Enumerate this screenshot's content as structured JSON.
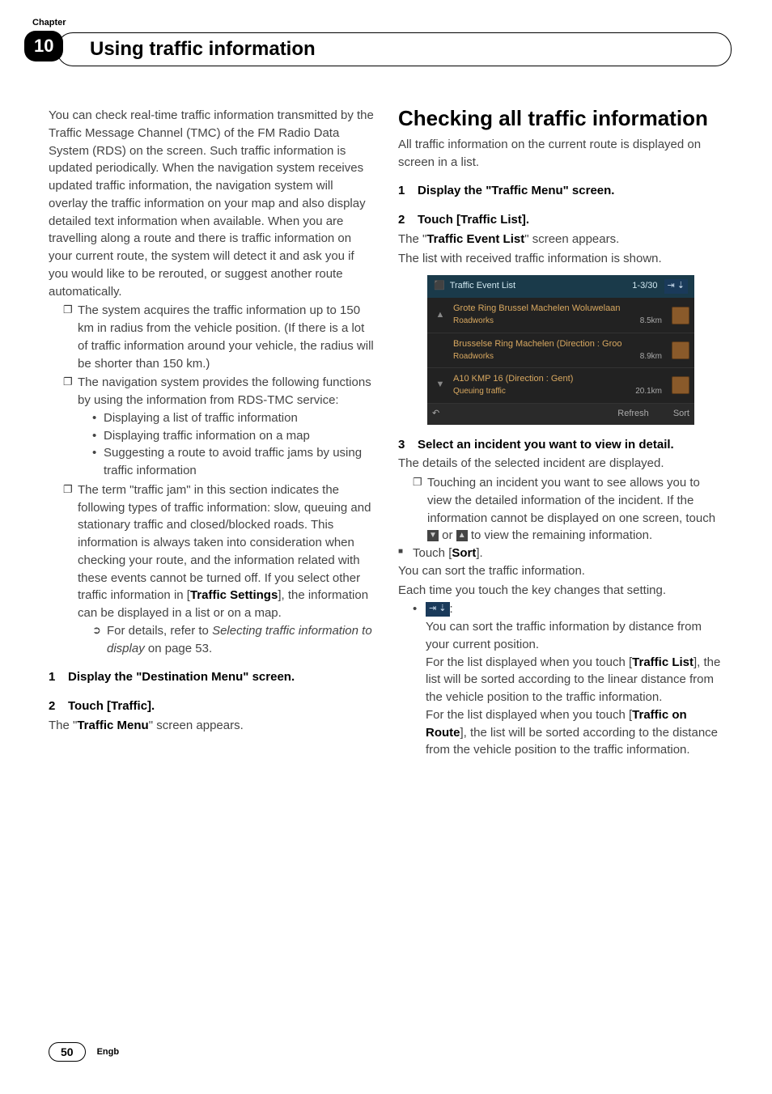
{
  "header": {
    "chapter_label": "Chapter",
    "chapter_number": "10",
    "chapter_title": "Using traffic information"
  },
  "left": {
    "intro": "You can check real-time traffic information transmitted by the Traffic Message Channel (TMC) of the FM Radio Data System (RDS) on the screen. Such traffic information is updated periodically. When the navigation system receives updated traffic information, the navigation system will overlay the traffic information on your map and also display detailed text information when available. When you are travelling along a route and there is traffic information on your current route, the system will detect it and ask you if you would like to be rerouted, or suggest another route automatically.",
    "b1": "The system acquires the traffic information up to 150 km in radius from the vehicle position. (If there is a lot of traffic information around your vehicle, the radius will be shorter than 150 km.)",
    "b2": "The navigation system provides the following functions by using the information from RDS-TMC service:",
    "b2s1": "Displaying a list of traffic information",
    "b2s2": "Displaying traffic information on a map",
    "b2s3": "Suggesting a route to avoid traffic jams by using traffic information",
    "b3a": "The term \"traffic jam\" in this section indicates the following types of traffic information: slow, queuing and stationary traffic and closed/blocked roads. This information is always taken into consideration when checking your route, and the information related with these events cannot be turned off. If you select other traffic information in [",
    "b3bold": "Traffic Settings",
    "b3b": "], the information can be displayed in a list or on a map.",
    "b3ref_a": "For details, refer to ",
    "b3ref_i": "Selecting traffic information to display",
    "b3ref_b": " on page 53.",
    "step1": "Display the \"Destination Menu\" screen.",
    "step2": "Touch [Traffic].",
    "step2_after_a": "The \"",
    "step2_after_bold": "Traffic Menu",
    "step2_after_b": "\" screen appears."
  },
  "right": {
    "heading": "Checking all traffic information",
    "intro": "All traffic information on the current route is displayed on screen in a list.",
    "step1": "Display the \"Traffic Menu\" screen.",
    "step2": "Touch [Traffic List].",
    "step2_after_a": "The \"",
    "step2_after_bold": "Traffic Event List",
    "step2_after_b": "\" screen appears.",
    "step2_after2": "The list with received traffic information is shown.",
    "screenshot": {
      "title": "Traffic Event List",
      "counter": "1-3/30",
      "rows": [
        {
          "road": "Grote Ring Brussel Machelen Woluwelaan",
          "type": "Roadworks",
          "dist": "8.5km"
        },
        {
          "road": "Brusselse Ring Machelen (Direction : Groo",
          "type": "Roadworks",
          "dist": "8.9km"
        },
        {
          "road": "A10 KMP 16 (Direction : Gent)",
          "type": "Queuing traffic",
          "dist": "20.1km"
        }
      ],
      "refresh": "Refresh",
      "sort": "Sort"
    },
    "step3": "Select an incident you want to view in detail.",
    "step3_after": "The details of the selected incident are displayed.",
    "step3_b1a": "Touching an incident you want to see allows you to view the detailed information of the incident. If the information cannot be displayed on one screen, touch ",
    "step3_b1b": " or ",
    "step3_b1c": " to view the remaining information.",
    "sort_touch_a": "Touch [",
    "sort_touch_bold": "Sort",
    "sort_touch_b": "].",
    "sort_p1": "You can sort the traffic information.",
    "sort_p2": "Each time you touch the key changes that setting.",
    "sort_opt1_a": "You can sort the traffic information by distance from your current position.",
    "sort_opt1_b_a": "For the list displayed when you touch [",
    "sort_opt1_b_bold": "Traffic List",
    "sort_opt1_b_b": "], the list will be sorted according to the linear distance from the vehicle position to the traffic information.",
    "sort_opt1_c_a": "For the list displayed when you touch [",
    "sort_opt1_c_bold": "Traffic on Route",
    "sort_opt1_c_b": "], the list will be sorted according to the distance from the vehicle position to the traffic information."
  },
  "footer": {
    "page": "50",
    "lang": "Engb"
  }
}
